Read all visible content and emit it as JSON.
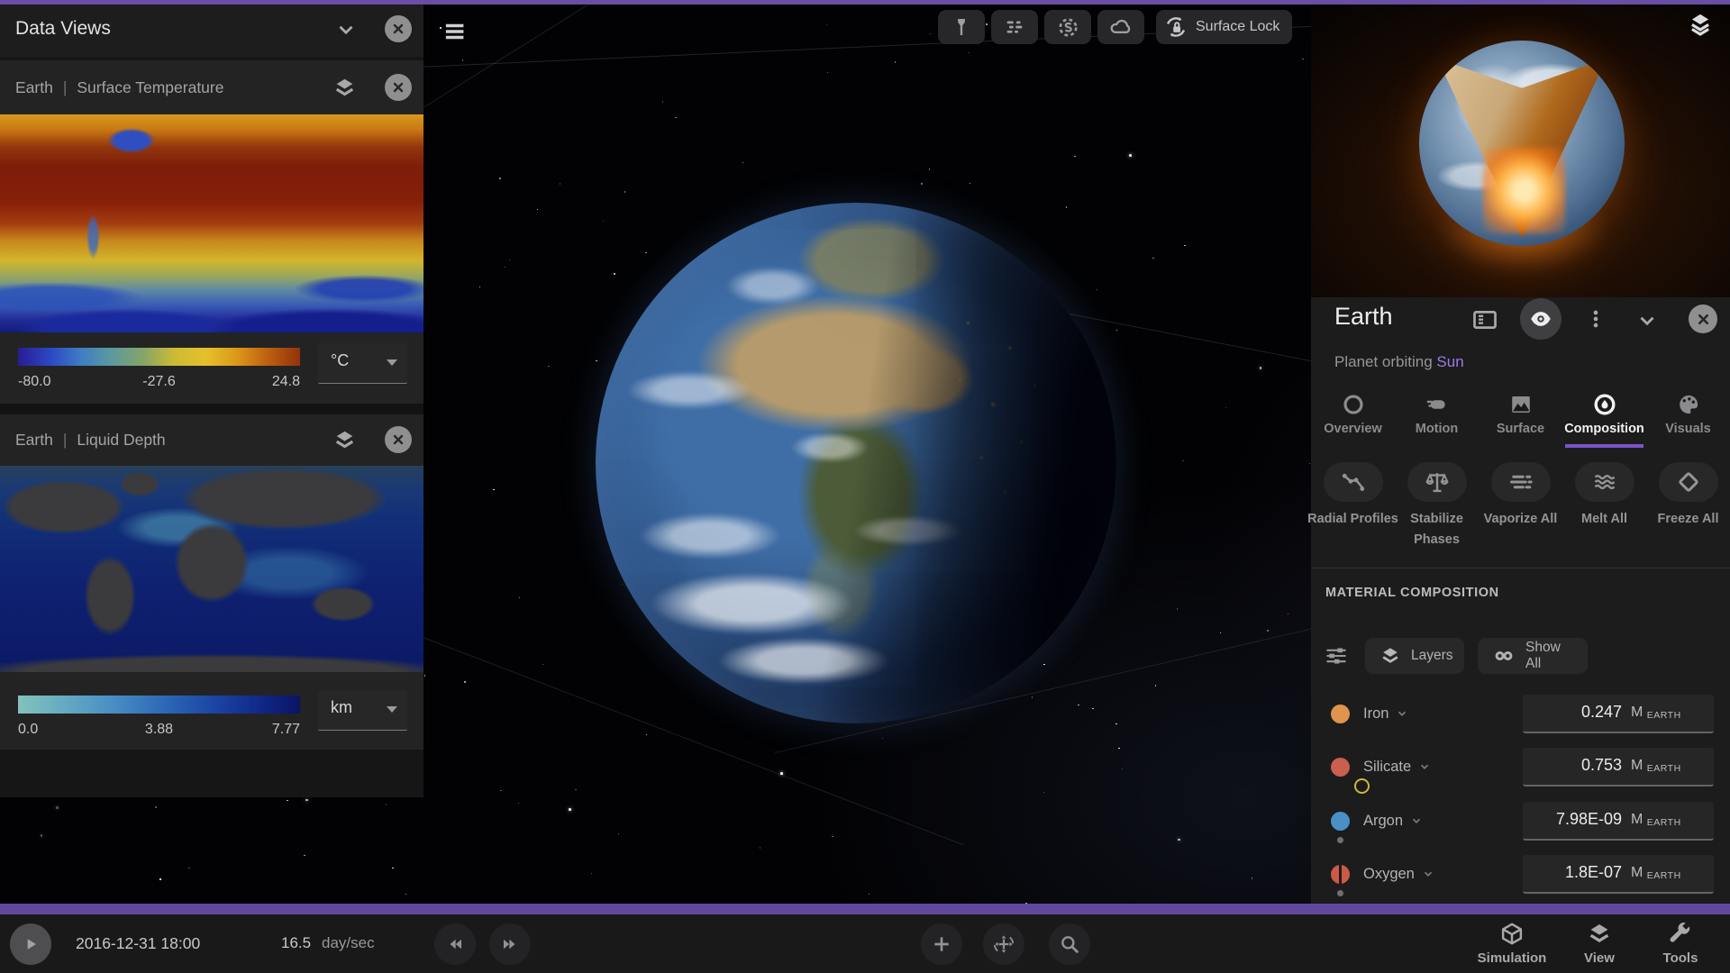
{
  "colors": {
    "accent_purple": "#694fa3",
    "tab_underline": "#7a55c8",
    "sun_link": "#9b7ce8"
  },
  "left_panel": {
    "title": "Data Views",
    "views": [
      {
        "planet": "Earth",
        "separator": "|",
        "metric": "Surface Temperature",
        "scale": {
          "min": "-80.0",
          "mid": "-27.6",
          "max": "24.8",
          "unit": "°C",
          "stops": [
            "#281c92",
            "#2c46c4",
            "#3f7cc4",
            "#5d9a9c",
            "#86a468",
            "#cdbb34",
            "#e5c02c",
            "#dc9718",
            "#bc5e10",
            "#93320a"
          ]
        }
      },
      {
        "planet": "Earth",
        "separator": "|",
        "metric": "Liquid Depth",
        "scale": {
          "min": "0.0",
          "mid": "3.88",
          "max": "7.77",
          "unit": "km",
          "stops": [
            "#84c2bc",
            "#64aac2",
            "#4a8ec4",
            "#2f6cb8",
            "#1d4aa8",
            "#122c8e",
            "#0a1464"
          ]
        }
      }
    ]
  },
  "viewport": {
    "surface_lock": "Surface Lock"
  },
  "right_panel": {
    "title": "Earth",
    "subtitle": "Planet orbiting",
    "subtitle_link": "Sun",
    "tabs": [
      {
        "label": "Overview"
      },
      {
        "label": "Motion"
      },
      {
        "label": "Surface"
      },
      {
        "label": "Composition"
      },
      {
        "label": "Visuals"
      }
    ],
    "active_tab": "Composition",
    "actions": [
      {
        "label": "Radial Profiles"
      },
      {
        "label": "Stabilize Phases"
      },
      {
        "label": "Vaporize All"
      },
      {
        "label": "Melt All"
      },
      {
        "label": "Freeze All"
      }
    ],
    "section_title": "MATERIAL COMPOSITION",
    "layers_button": "Layers",
    "show_all_button": "Show All",
    "materials": [
      {
        "name": "Iron",
        "value": "0.247",
        "unit": "M",
        "unit_sub": "EARTH",
        "color": "#e0944c",
        "shape": "circle",
        "dot": false
      },
      {
        "name": "Silicate",
        "value": "0.753",
        "unit": "M",
        "unit_sub": "EARTH",
        "color": "#c95f4e",
        "shape": "cluster",
        "dot": false
      },
      {
        "name": "Argon",
        "value": "7.98E-09",
        "unit": "M",
        "unit_sub": "EARTH",
        "color": "#4a8fc7",
        "shape": "circle",
        "dot": true
      },
      {
        "name": "Oxygen",
        "value": "1.8E-07",
        "unit": "M",
        "unit_sub": "EARTH",
        "color": "#cc5948",
        "shape": "split",
        "dot": true
      }
    ]
  },
  "bottom_bar": {
    "datetime": "2016-12-31 18:00",
    "speed_value": "16.5",
    "speed_unit": "day/sec",
    "menu": [
      {
        "label": "Simulation"
      },
      {
        "label": "View"
      },
      {
        "label": "Tools"
      }
    ]
  }
}
